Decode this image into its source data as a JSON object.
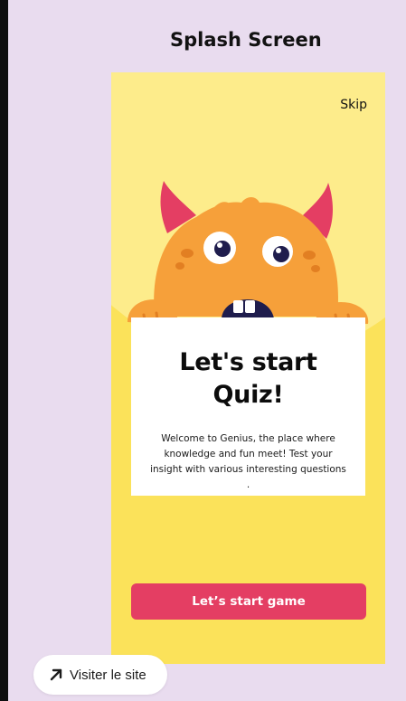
{
  "page": {
    "title": "Splash Screen"
  },
  "phone": {
    "skip_label": "Skip",
    "card": {
      "heading_line1": "Let's start",
      "heading_line2": "Quiz!",
      "description": "Welcome to Genius, the place where knowledge and fun meet! Test your insight with various interesting questions ."
    },
    "start_button_label": "Let’s start game"
  },
  "footer": {
    "visit_label": "Visiter le site"
  },
  "colors": {
    "background": "#e9dcef",
    "phone_bg": "#fbe25a",
    "hill": "#fdec8b",
    "monster_body": "#f6a03a",
    "horns": "#e43e63",
    "button": "#e43e63"
  },
  "icons": {
    "visit": "arrow-up-right-icon",
    "mascot": "monster-mascot"
  }
}
